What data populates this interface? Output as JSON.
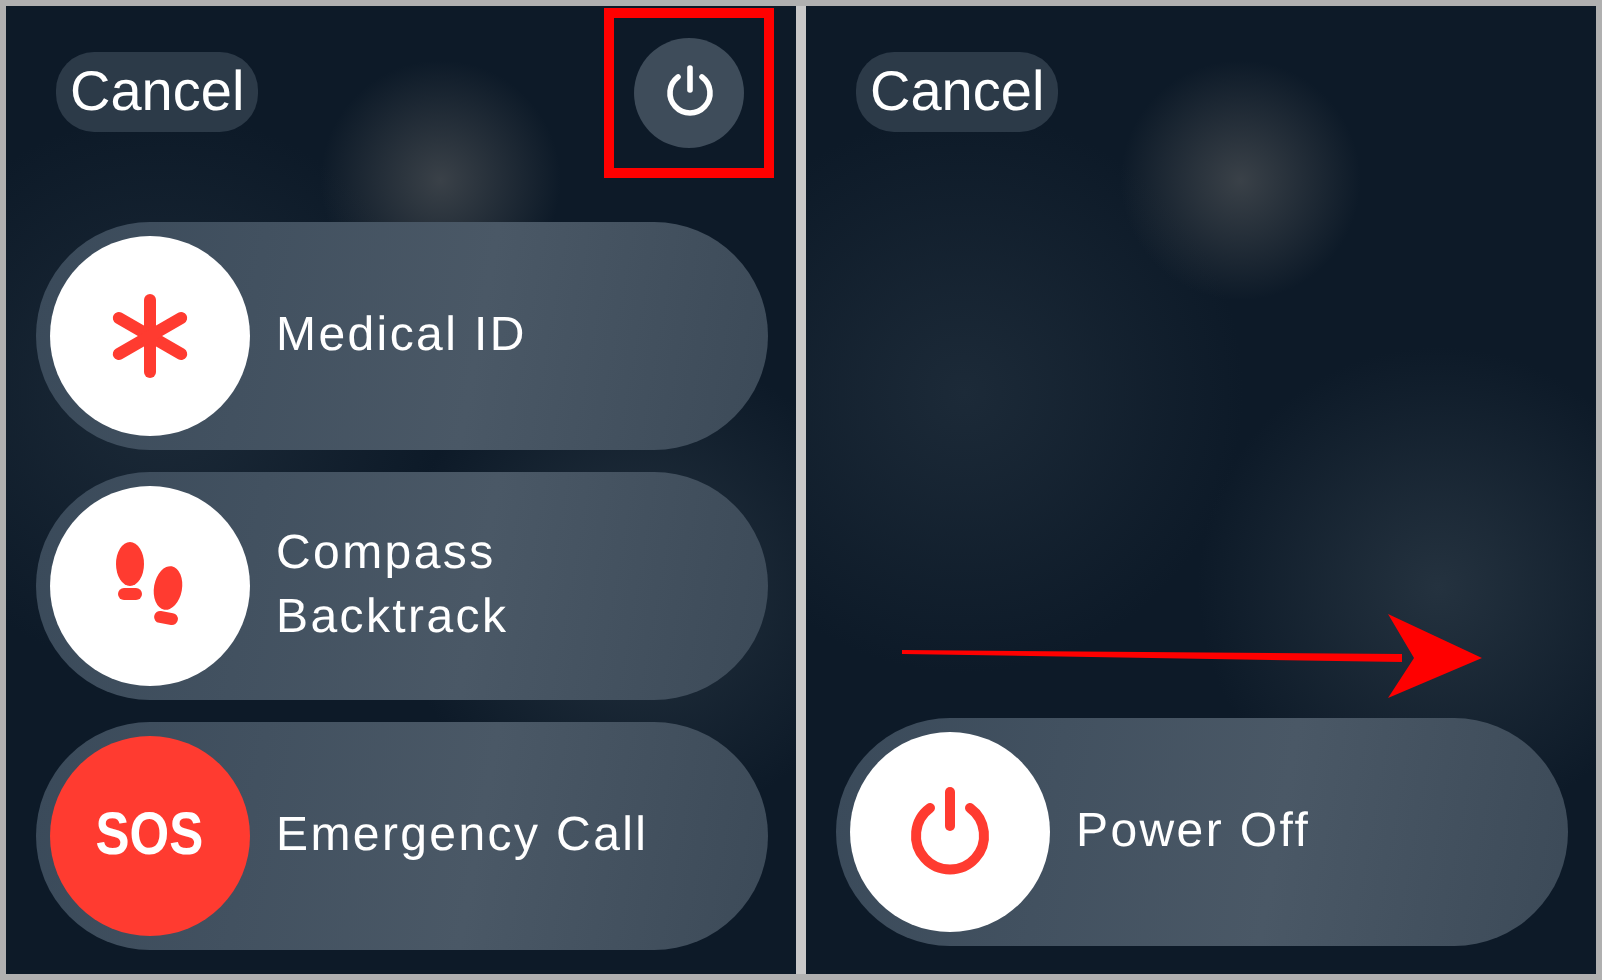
{
  "panels": [
    {
      "cancel": "Cancel",
      "power_button": {
        "highlighted": true
      },
      "swipe_arrow": false,
      "sliders": [
        {
          "kind": "medical",
          "label": "Medical ID"
        },
        {
          "kind": "backtrack",
          "label": "Compass Backtrack"
        },
        {
          "kind": "sos",
          "label": "Emergency Call",
          "knob_text": "SOS"
        }
      ]
    },
    {
      "cancel": "Cancel",
      "swipe_arrow": true,
      "sliders": [
        {
          "kind": "power",
          "label": "Power Off"
        }
      ]
    }
  ]
}
